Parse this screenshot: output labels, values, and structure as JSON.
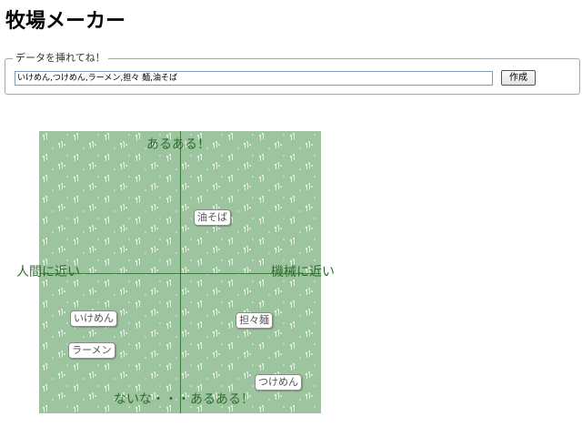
{
  "page": {
    "title": "牧場メーカー"
  },
  "form": {
    "legend": "データを挿れてね！",
    "input_value": "いけめん,つけめん,ラーメン,担々 麺,油そば",
    "create_label": "作成"
  },
  "board": {
    "label_top": "あるある！",
    "label_bottom": "ないな・・・あるある！",
    "label_left": "人間に近い",
    "label_right": "機械に近い",
    "items": [
      {
        "label": "油そば"
      },
      {
        "label": "いけめん"
      },
      {
        "label": "担々麺"
      },
      {
        "label": "ラーメン"
      },
      {
        "label": "つけめん"
      }
    ]
  },
  "colors": {
    "board_background": "#9cc49e",
    "axis_color": "#3e7a3e",
    "label_color": "#2f6b2f"
  }
}
